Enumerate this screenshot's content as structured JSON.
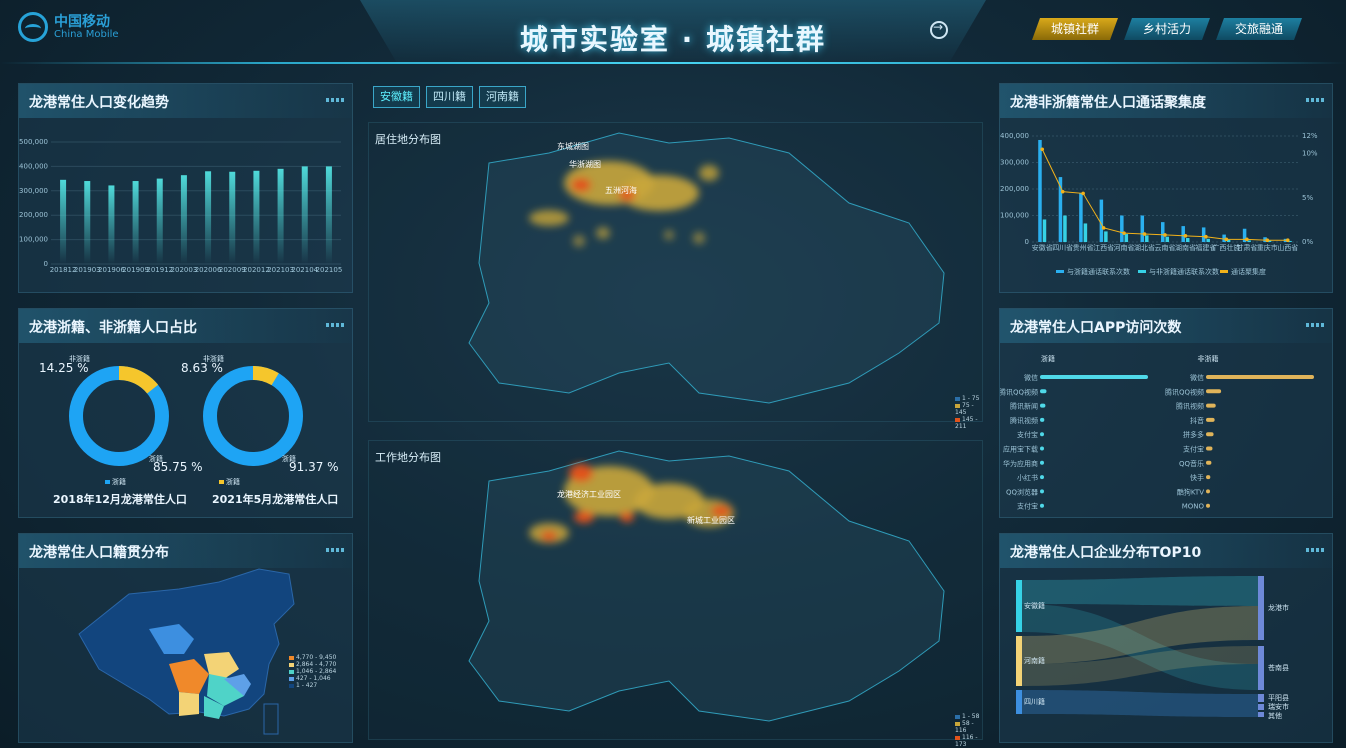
{
  "header": {
    "logo_cn": "中国移动",
    "logo_en": "China Mobile",
    "title": "城市实验室 · 城镇社群",
    "tabs": [
      {
        "label": "城镇社群",
        "active": true
      },
      {
        "label": "乡村活力",
        "active": false
      },
      {
        "label": "交旅融通",
        "active": false
      }
    ]
  },
  "panels": {
    "trend": {
      "title": "龙港常住人口变化趋势"
    },
    "ratio": {
      "title": "龙港浙籍、非浙籍人口占比"
    },
    "origin": {
      "title": "龙港常住人口籍贯分布"
    },
    "call": {
      "title": "龙港非浙籍常住人口通话聚集度"
    },
    "app": {
      "title": "龙港常住人口APP访问次数"
    },
    "enterprise": {
      "title": "龙港常住人口企业分布TOP10"
    }
  },
  "center": {
    "tabs": [
      {
        "label": "安徽籍",
        "active": true
      },
      {
        "label": "四川籍",
        "active": false
      },
      {
        "label": "河南籍",
        "active": false
      }
    ],
    "residence_title": "居住地分布图",
    "work_title": "工作地分布图",
    "residence_labels": [
      "东城湖图",
      "华浙湖图",
      "五洲河海"
    ],
    "work_labels": [
      "龙港经济工业园区",
      "新城工业园区"
    ],
    "residence_legend": [
      "1 - 75",
      "75 - 145",
      "145 - 211"
    ],
    "work_legend": [
      "1 - 58",
      "58 - 116",
      "116 - 173"
    ]
  },
  "ratio": {
    "donuts": [
      {
        "caption": "2018年12月龙港常住人口",
        "non_zj_label": "非浙籍",
        "zj_label": "浙籍",
        "non_zj_pct": "14.25 %",
        "zj_pct": "85.75 %",
        "non_zj_value": 14.25
      },
      {
        "caption": "2021年5月龙港常住人口",
        "non_zj_label": "非浙籍",
        "zj_label": "浙籍",
        "non_zj_pct": "8.63 %",
        "zj_pct": "91.37 %",
        "non_zj_value": 8.63
      }
    ],
    "legend_label": "浙籍"
  },
  "origin": {
    "legend": [
      "4,770 - 9,450",
      "2,864 - 4,770",
      "1,046 - 2,864",
      "427 - 1,046",
      "1 - 427"
    ]
  },
  "app": {
    "left_head": "浙籍",
    "right_head": "非浙籍",
    "left": [
      {
        "name": "微信",
        "value": 100
      },
      {
        "name": "腾讯QQ视频",
        "value": 6
      },
      {
        "name": "腾讯新闻",
        "value": 5
      },
      {
        "name": "腾讯视频",
        "value": 4
      },
      {
        "name": "支付宝",
        "value": 3
      },
      {
        "name": "应用宝下载",
        "value": 3
      },
      {
        "name": "华为应用商",
        "value": 2
      },
      {
        "name": "小红书",
        "value": 2
      },
      {
        "name": "QQ浏览器",
        "value": 2
      },
      {
        "name": "支付宝",
        "value": 2
      }
    ],
    "right": [
      {
        "name": "微信",
        "value": 100
      },
      {
        "name": "腾讯QQ视频",
        "value": 14
      },
      {
        "name": "腾讯视频",
        "value": 9
      },
      {
        "name": "抖音",
        "value": 8
      },
      {
        "name": "拼多多",
        "value": 7
      },
      {
        "name": "支付宝",
        "value": 6
      },
      {
        "name": "QQ音乐",
        "value": 5
      },
      {
        "name": "快手",
        "value": 4
      },
      {
        "name": "酷狗KTV",
        "value": 3
      },
      {
        "name": "MONO",
        "value": 2
      }
    ]
  },
  "enterprise": {
    "left_nodes": [
      "安徽籍",
      "河南籍",
      "四川籍"
    ],
    "right_nodes": [
      "龙港市",
      "苍南县",
      "平阳县",
      "瑞安市",
      "其他"
    ]
  },
  "chart_data": [
    {
      "type": "bar",
      "title": "龙港常住人口变化趋势",
      "categories": [
        "201812",
        "201903",
        "201906",
        "201909",
        "201912",
        "202003",
        "202006",
        "202009",
        "202012",
        "202103",
        "202104",
        "202105"
      ],
      "values": [
        345000,
        340000,
        322000,
        340000,
        350000,
        364000,
        380000,
        378000,
        382000,
        390000,
        400000,
        400000
      ],
      "yticks": [
        "500,000",
        "400,000",
        "300,000",
        "200,000",
        "100,000",
        "0"
      ],
      "ylim": [
        0,
        500000
      ]
    },
    {
      "type": "bar",
      "title": "龙港非浙籍常住人口通话聚集度",
      "categories": [
        "安徽省",
        "四川省",
        "贵州省",
        "江西省",
        "河南省",
        "湖北省",
        "云南省",
        "湖南省",
        "福建省",
        "广西壮族自治区",
        "甘肃省",
        "重庆市",
        "山西省"
      ],
      "series": [
        {
          "name": "与浙籍通话联系次数",
          "values": [
            385000,
            245000,
            185000,
            160000,
            100000,
            100000,
            75000,
            60000,
            55000,
            28000,
            50000,
            18000,
            12000
          ]
        },
        {
          "name": "与非浙籍通话联系次数",
          "values": [
            85000,
            100000,
            70000,
            40000,
            30000,
            25000,
            20000,
            15000,
            12000,
            8000,
            6000,
            5000,
            4000
          ]
        },
        {
          "name": "通话聚集度",
          "values": [
            10.5,
            5.7,
            5.5,
            1.6,
            1.0,
            0.9,
            0.8,
            0.7,
            0.6,
            0.3,
            0.3,
            0.2,
            0.2
          ]
        }
      ],
      "yticks_left": [
        "400,000",
        "300,000",
        "200,000",
        "100,000",
        "0"
      ],
      "yticks_right": [
        "12%",
        "10%",
        "5%",
        "0%"
      ],
      "legend": [
        "与浙籍通话联系次数",
        "与非浙籍通话联系次数",
        "通话聚集度"
      ]
    },
    {
      "type": "pie",
      "title": "2018年12月龙港常住人口",
      "categories": [
        "非浙籍",
        "浙籍"
      ],
      "values": [
        14.25,
        85.75
      ]
    },
    {
      "type": "pie",
      "title": "2021年5月龙港常住人口",
      "categories": [
        "非浙籍",
        "浙籍"
      ],
      "values": [
        8.63,
        91.37
      ]
    }
  ],
  "colors": {
    "accent": "#3fc0e6",
    "bar_teal": "#4fd9d9",
    "donut_blue": "#1ea4f4",
    "donut_yellow": "#f5c62c",
    "call_blue": "#2ab0f0",
    "call_cyan": "#36d2e6",
    "line_yellow": "#f2b21a",
    "heat_yellow": "#c9a63a",
    "heat_orange": "#e0531c"
  }
}
